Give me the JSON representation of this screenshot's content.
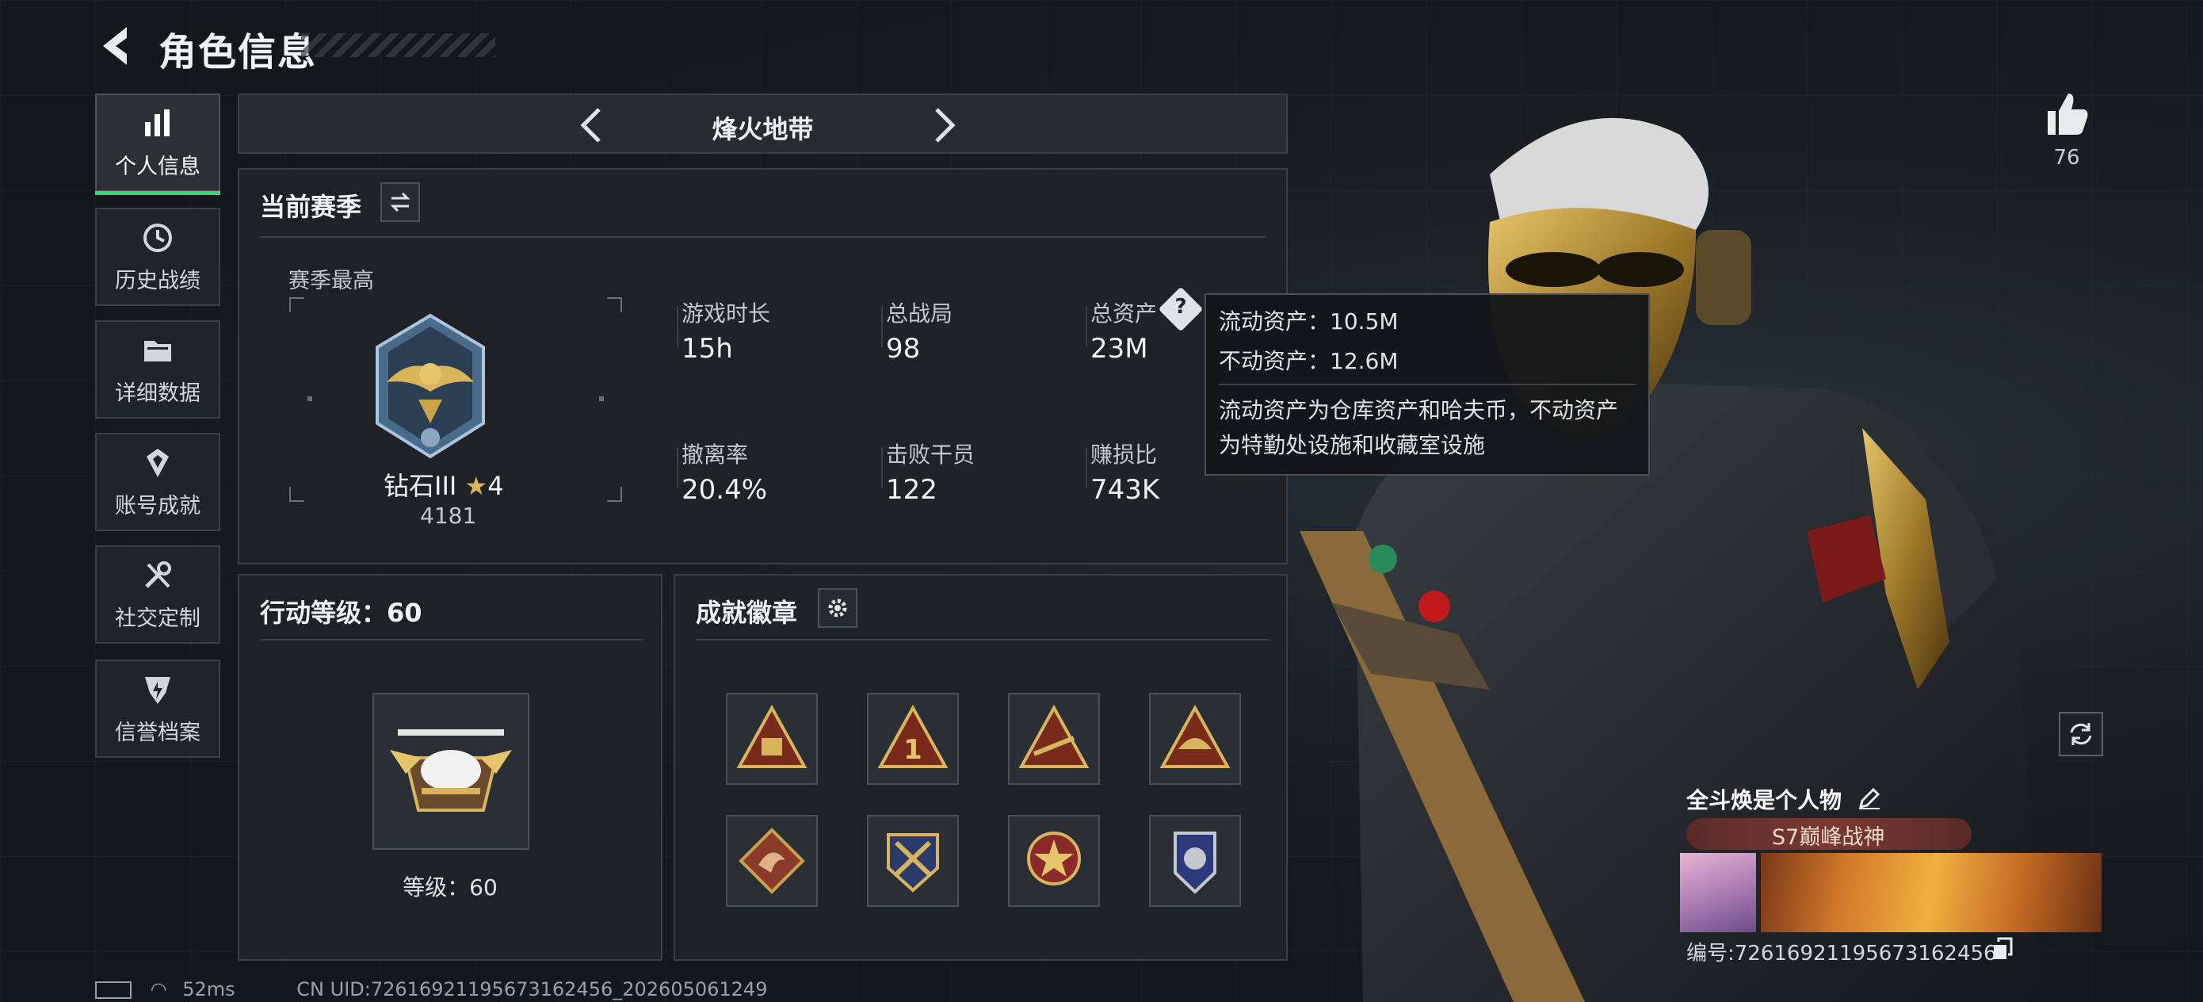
{
  "header": {
    "title": "角色信息"
  },
  "sidebar": {
    "items": [
      {
        "label": "个人信息",
        "icon": "bar-chart-icon",
        "active": true
      },
      {
        "label": "历史战绩",
        "icon": "history-clock-icon",
        "active": false
      },
      {
        "label": "详细数据",
        "icon": "folder-icon",
        "active": false
      },
      {
        "label": "账号成就",
        "icon": "achievement-icon",
        "active": false
      },
      {
        "label": "社交定制",
        "icon": "wrench-icon",
        "active": false
      },
      {
        "label": "信誉档案",
        "icon": "shield-icon",
        "active": false
      }
    ]
  },
  "mode": {
    "label": "烽火地带"
  },
  "season": {
    "title": "当前赛季",
    "best_label": "赛季最高",
    "rank_name": "钻石III",
    "rank_stars": "4",
    "rank_score": "4181",
    "stats": [
      {
        "label": "游戏时长",
        "value": "15h"
      },
      {
        "label": "总战局",
        "value": "98"
      },
      {
        "label": "总资产",
        "value": "23M"
      },
      {
        "label": "撤离率",
        "value": "20.4%"
      },
      {
        "label": "击败干员",
        "value": "122"
      },
      {
        "label": "赚损比",
        "value": "743K"
      }
    ],
    "help_mark": "?"
  },
  "tooltip": {
    "liquid": "流动资产：10.5M",
    "fixed": "不动资产：12.6M",
    "note_line1": "流动资产为仓库资产和哈夫币，不动资产",
    "note_line2": "为特勤处设施和收藏室设施"
  },
  "action_level": {
    "title": "行动等级：60",
    "level_text": "等级：60"
  },
  "badges": {
    "title": "成就徽章",
    "items": [
      "badge-triangle-crate",
      "badge-triangle-1",
      "badge-triangle-gun",
      "badge-triangle-ship",
      "badge-dragon",
      "badge-crossed-rifles",
      "badge-star-cross",
      "badge-police"
    ]
  },
  "likes": {
    "count": "76"
  },
  "profile_card": {
    "name": "全斗焕是个人物",
    "title": "S7巅峰战神",
    "id": "编号:7261692119567316245​6"
  },
  "status": {
    "ping": "52ms",
    "uid": "CN UID:7261692119567316245​6_202605061249"
  },
  "colors": {
    "accent_green": "#3fd07a",
    "gold": "#c9a24a",
    "panel": "#1f2328"
  }
}
